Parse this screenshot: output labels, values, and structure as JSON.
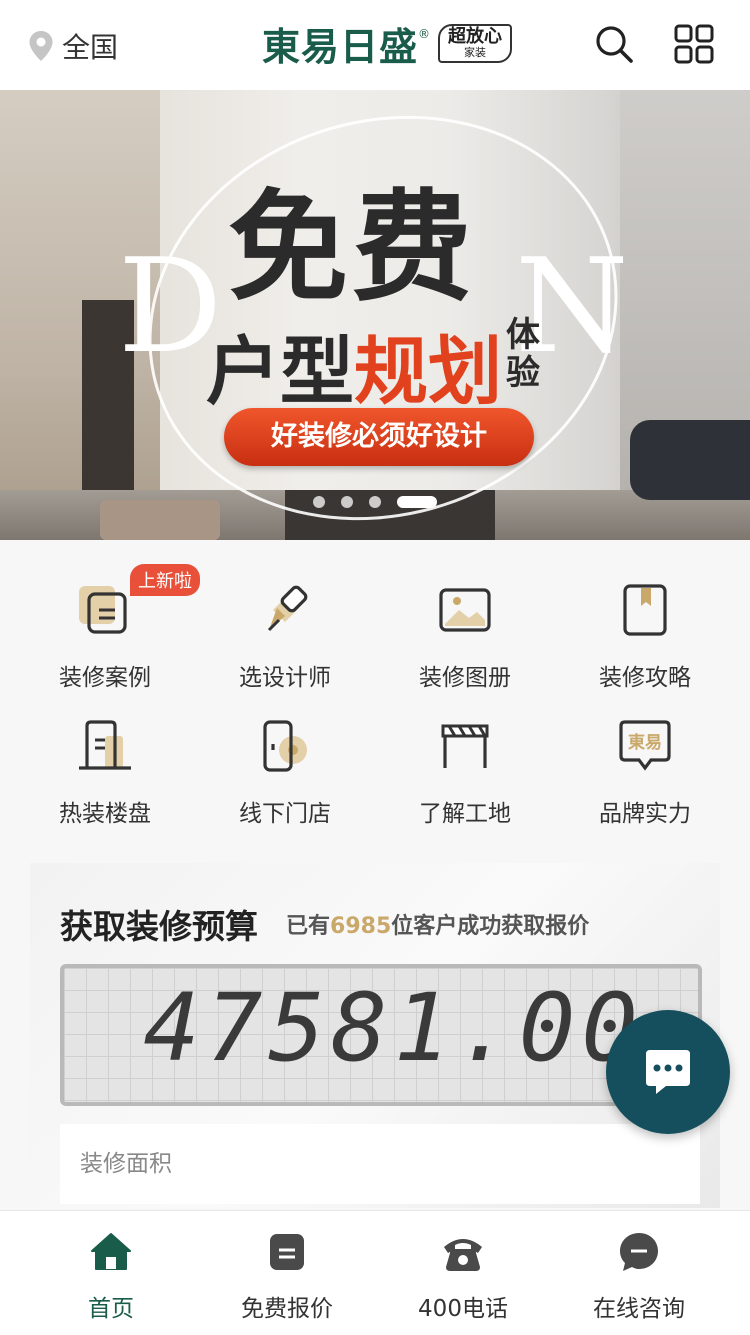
{
  "header": {
    "location": "全国",
    "brand_name": "東易日盛",
    "brand_sub_line1": "超放心",
    "brand_sub_line2": "家装",
    "brand_mark": "®"
  },
  "banner": {
    "deco_left": "D",
    "deco_right": "N",
    "headline": "免费",
    "line2_a": "户型",
    "line2_b": "规划",
    "line2_c": "体验",
    "cta": "好装修必须好设计",
    "slides": 4,
    "active_slide": 4
  },
  "nav": {
    "badge": "上新啦",
    "items": [
      {
        "label": "装修案例",
        "icon": "case-doc-icon"
      },
      {
        "label": "选设计师",
        "icon": "pen-icon"
      },
      {
        "label": "装修图册",
        "icon": "picture-icon"
      },
      {
        "label": "装修攻略",
        "icon": "book-icon"
      },
      {
        "label": "热装楼盘",
        "icon": "building-icon"
      },
      {
        "label": "线下门店",
        "icon": "store-door-icon"
      },
      {
        "label": "了解工地",
        "icon": "construction-icon"
      },
      {
        "label": "品牌实力",
        "icon": "brand-icon"
      }
    ],
    "brand_icon_text": "東易"
  },
  "budget": {
    "title": "获取装修预算",
    "sub_prefix": "已有",
    "count": "6985",
    "sub_suffix": "位客户成功获取报价",
    "amount": "47581.00",
    "area_placeholder": "装修面积"
  },
  "tabbar": {
    "items": [
      {
        "label": "首页",
        "icon": "home-icon"
      },
      {
        "label": "免费报价",
        "icon": "quote-icon"
      },
      {
        "label": "400电话",
        "icon": "phone-icon"
      },
      {
        "label": "在线咨询",
        "icon": "chat-bubble-icon"
      }
    ],
    "active": 0
  },
  "colors": {
    "brand_green": "#1a5c4a",
    "accent_red": "#e2411d",
    "accent_gold": "#c9a86a",
    "fab_teal": "#154f5e"
  }
}
